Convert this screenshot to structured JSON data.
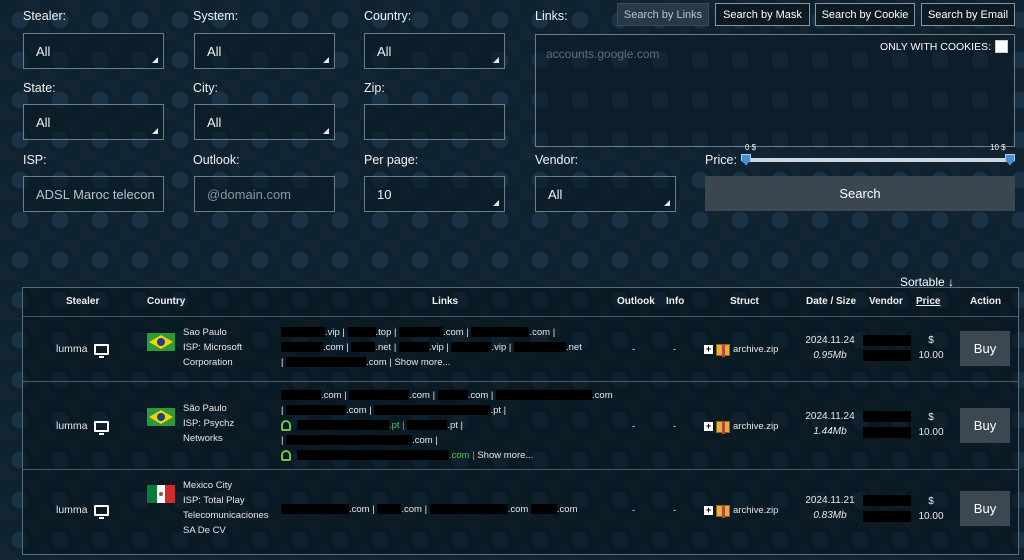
{
  "filters": {
    "stealer": {
      "label": "Stealer:",
      "value": "All"
    },
    "system": {
      "label": "System:",
      "value": "All"
    },
    "country": {
      "label": "Country:",
      "value": "All"
    },
    "links": {
      "label": "Links:",
      "placeholder": "accounts.google.com"
    },
    "state": {
      "label": "State:",
      "value": "All"
    },
    "city": {
      "label": "City:",
      "value": "All"
    },
    "zip": {
      "label": "Zip:",
      "value": ""
    },
    "isp": {
      "label": "ISP:",
      "value": "ADSL Maroc telecon"
    },
    "outlook": {
      "label": "Outlook:",
      "placeholder": "@domain.com"
    },
    "per_page": {
      "label": "Per page:",
      "value": "10"
    },
    "vendor": {
      "label": "Vendor:",
      "value": "All"
    },
    "price": {
      "label": "Price:",
      "min": "0 $",
      "max": "10 $"
    },
    "only_cookies": "ONLY WITH COOKIES:",
    "search": "Search"
  },
  "search_modes": [
    "Search by Links",
    "Search by Mask",
    "Search by Cookie",
    "Search by Email"
  ],
  "sortable": "Sortable",
  "table": {
    "headers": [
      "Stealer",
      "Country",
      "Links",
      "Outlook",
      "Info",
      "Struct",
      "Date / Size",
      "Vendor",
      "Price",
      "Action"
    ],
    "rows": [
      {
        "stealer": "lumma",
        "country_city": "Sao Paulo",
        "isp": "ISP: Microsoft Corporation",
        "outlook": "-",
        "info": "-",
        "struct": "archive.zip",
        "date": "2024.11.24",
        "size": "0.95Mb",
        "currency": "$",
        "price": "10.00",
        "action": "Buy",
        "show_more": "Show more..."
      },
      {
        "stealer": "lumma",
        "country_city": "São Paulo",
        "isp": "ISP: Psychz Networks",
        "outlook": "-",
        "info": "-",
        "struct": "archive.zip",
        "date": "2024.11.24",
        "size": "1.44Mb",
        "currency": "$",
        "price": "10.00",
        "action": "Buy",
        "show_more": "Show more..."
      },
      {
        "stealer": "lumma",
        "country_city": "Mexico City",
        "isp": "ISP: Total Play Telecomunicaciones SA De CV",
        "outlook": "-",
        "info": "-",
        "struct": "archive.zip",
        "date": "2024.11.21",
        "size": "0.83Mb",
        "currency": "$",
        "price": "10.00",
        "action": "Buy"
      }
    ]
  },
  "link_fragments": {
    "r1a": [
      ".vip |",
      ".top |",
      ".com |",
      ".com |"
    ],
    "r1b": [
      ".com |",
      ".net |",
      ".vip |",
      ".vip |",
      ".net"
    ],
    "r1c": [
      ".com |"
    ],
    "r2a": [
      ".com |",
      ".com |",
      ".com |",
      ".com"
    ],
    "r2b": [
      ".com |",
      ".pt |"
    ],
    "r2c": [
      ".pt |",
      ".pt |"
    ],
    "r2d": [
      ".com |"
    ],
    "r2e": [
      ".com |"
    ],
    "r3a": [
      ".com |",
      ".com |",
      ".com",
      ".com"
    ]
  },
  "colors": {
    "accent": "#4a8fd0",
    "button": "#3b4852",
    "link_green": "#4fc04f"
  }
}
